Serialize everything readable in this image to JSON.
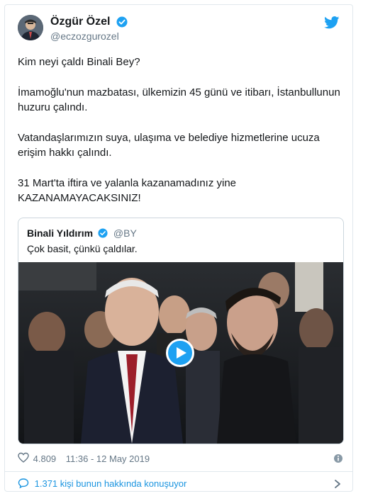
{
  "tweet": {
    "author": {
      "display_name": "Özgür Özel",
      "handle": "@eczozgurozel",
      "verified": true
    },
    "paragraphs": [
      "Kim neyi çaldı Binali Bey?",
      "İmamoğlu'nun mazbatası, ülkemizin 45 günü ve itibarı, İstanbullunun huzuru çalındı.",
      "Vatandaşlarımızın suya, ulaşıma ve belediye hizmetlerine ucuza erişim hakkı çalındı.",
      "31 Mart'ta iftira ve yalanla kazanamadınız yine KAZANAMAYACAKSINIZ!"
    ]
  },
  "quoted_tweet": {
    "display_name": "Binali Yıldırım",
    "handle": "@BY",
    "text": "Çok basit, çünkü çaldılar."
  },
  "footer": {
    "likes": "4.809",
    "timestamp": "11:36 - 12 May 2019"
  },
  "conversation": {
    "label": "1.371 kişi bunun hakkında konuşuyor"
  },
  "icons": {
    "twitter": "twitter-bird-icon",
    "verified": "verified-badge-icon",
    "heart": "heart-icon",
    "info": "info-icon",
    "bubble": "speech-bubble-icon",
    "chevron": "chevron-right-icon",
    "play": "play-icon"
  },
  "colors": {
    "brand_blue": "#1da1f2",
    "link_blue": "#1b95e0",
    "text": "#14171a",
    "muted": "#657786",
    "border": "#e1e8ed"
  }
}
